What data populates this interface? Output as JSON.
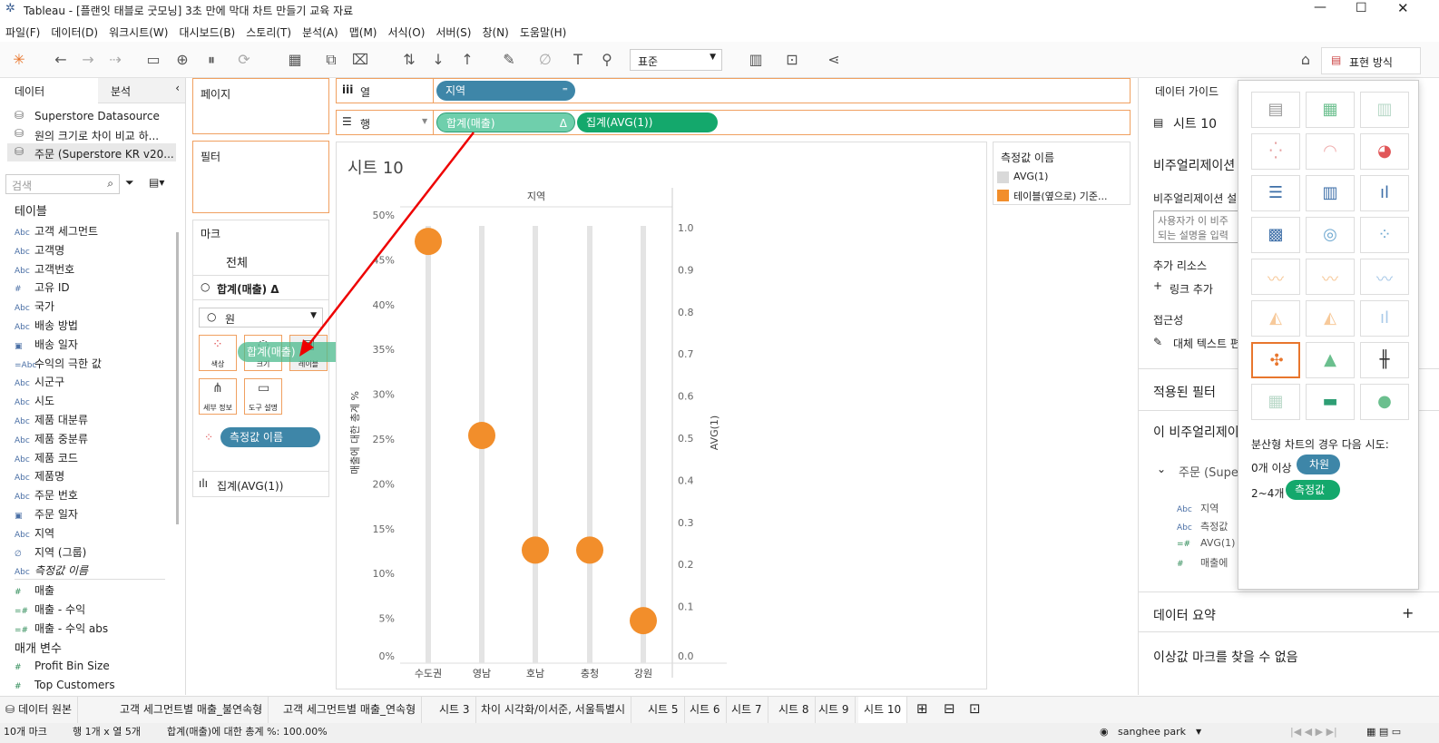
{
  "window": {
    "title": "Tableau - [플랜잇 태블로 굿모닝] 3초 만에 막대 차트 만들기 교육 자료"
  },
  "menu": [
    "파일(F)",
    "데이터(D)",
    "워크시트(W)",
    "대시보드(B)",
    "스토리(T)",
    "분석(A)",
    "맵(M)",
    "서식(O)",
    "서버(S)",
    "창(N)",
    "도움말(H)"
  ],
  "toolbar": {
    "fit": "표준",
    "show_me": "표현 방식"
  },
  "left": {
    "tab_data": "데이터",
    "tab_analysis": "분석",
    "sources": [
      "Superstore Datasource",
      "원의 크기로 차이 비교 하...",
      "주문 (Superstore KR v20..."
    ],
    "search_placeholder": "검색",
    "tables_header": "테이블",
    "fields": [
      {
        "icon": "Abc",
        "name": "고객 세그먼트"
      },
      {
        "icon": "Abc",
        "name": "고객명"
      },
      {
        "icon": "Abc",
        "name": "고객번호"
      },
      {
        "icon": "#",
        "name": "고유 ID"
      },
      {
        "icon": "Abc",
        "name": "국가"
      },
      {
        "icon": "Abc",
        "name": "배송 방법"
      },
      {
        "icon": "▣",
        "name": "배송 일자"
      },
      {
        "icon": "=Abc",
        "name": "수익의 극한 값"
      },
      {
        "icon": "Abc",
        "name": "시군구"
      },
      {
        "icon": "Abc",
        "name": "시도"
      },
      {
        "icon": "Abc",
        "name": "제품 대분류"
      },
      {
        "icon": "Abc",
        "name": "제품 중분류"
      },
      {
        "icon": "Abc",
        "name": "제품 코드"
      },
      {
        "icon": "Abc",
        "name": "제품명"
      },
      {
        "icon": "Abc",
        "name": "주문 번호"
      },
      {
        "icon": "▣",
        "name": "주문 일자"
      },
      {
        "icon": "Abc",
        "name": "지역"
      },
      {
        "icon": "∅",
        "name": "지역 (그룹)"
      },
      {
        "icon": "Abc",
        "name": "측정값 이름"
      }
    ],
    "measures": [
      {
        "icon": "#",
        "name": "매출"
      },
      {
        "icon": "=#",
        "name": "매출 - 수익"
      },
      {
        "icon": "=#",
        "name": "매출 - 수익 abs"
      }
    ],
    "params_header": "매개 변수",
    "params": [
      {
        "icon": "#",
        "name": "Profit Bin Size"
      },
      {
        "icon": "#",
        "name": "Top Customers"
      }
    ]
  },
  "pages": {
    "label": "페이지"
  },
  "filters": {
    "label": "필터"
  },
  "marks": {
    "label": "마크",
    "all": "전체",
    "measure": "합계(매출) Δ",
    "type": "원",
    "buttons": [
      "색상",
      "크기",
      "레이블",
      "세부 정보",
      "도구 설명"
    ],
    "color_pill": "측정값 이름",
    "drag_pill": "합계(매출)",
    "agg": "집계(AVG(1))"
  },
  "columns": {
    "label": "열",
    "pill": "지역"
  },
  "rows": {
    "label": "행",
    "pill1": "합계(매출)",
    "pill1_delta": "Δ",
    "pill2": "집계(AVG(1))"
  },
  "sheet": {
    "title": "시트 10",
    "header": "지역",
    "y_left_label": "매출에 대한 총계 %",
    "y_right_label": "AVG(1)"
  },
  "legend": {
    "title": "측정값 이름",
    "items": [
      {
        "label": "AVG(1)",
        "color": "#d9d9d9"
      },
      {
        "label": "테이블(옆으로) 기준...",
        "color": "#f28e2b"
      }
    ]
  },
  "chart_data": {
    "type": "scatter",
    "categories": [
      "수도권",
      "영남",
      "호남",
      "충청",
      "강원"
    ],
    "values": [
      0.47,
      0.25,
      0.12,
      0.12,
      0.04
    ],
    "ylim": [
      0,
      0.5
    ],
    "y_ticks": [
      "0%",
      "5%",
      "10%",
      "15%",
      "20%",
      "25%",
      "30%",
      "35%",
      "40%",
      "45%",
      "50%"
    ],
    "y2_ticks": [
      "0.0",
      "0.1",
      "0.2",
      "0.3",
      "0.4",
      "0.5",
      "0.6",
      "0.7",
      "0.8",
      "0.9",
      "1.0"
    ],
    "ylim2": [
      0,
      1
    ]
  },
  "guide": {
    "title": "데이터 가이드",
    "sheet": "시트 10",
    "viz_label": "비주얼리제이션",
    "viz_desc_label": "비주얼리제이션 설",
    "desc_placeholder": "사용자가 이 비주\n되는 설명을 입력",
    "resources": "추가 리소스",
    "add_link": "링크 추가",
    "access": "접근성",
    "alt_text": "대체 텍스트 편",
    "filters": "적용된 필터",
    "this_viz": "이 비주얼리제이",
    "source": "주문 (Supe",
    "fields": [
      {
        "icon": "Abc",
        "name": "지역"
      },
      {
        "icon": "Abc",
        "name": "측정값 "
      },
      {
        "icon": "=#",
        "name": "AVG(1)"
      },
      {
        "icon": "#",
        "name": "매출에 "
      }
    ],
    "summary": "데이터 요약",
    "outlier": "이상값 마크를 찾을 수 없음"
  },
  "showme": {
    "hint": "분산형 차트의 경우 다음 시도:",
    "row1_prefix": "0개 이상",
    "row1_pill": "차원",
    "row2_prefix": "2~4개",
    "row2_pill": "측정값"
  },
  "tabs": [
    "데이터 원본",
    "고객 세그먼트별 매출_불연속형",
    "고객 세그먼트별 매출_연속형",
    "시트 3",
    "차이 시각화/이서준, 서울특별시",
    "시트 5",
    "시트 6",
    "시트 7",
    "시트 8",
    "시트 9",
    "시트 10"
  ],
  "status": {
    "marks": "10개 마크",
    "dims": "행 1개 x 열 5개",
    "calc": "합계(매출)에 대한 총계 %: 100.00%",
    "user": "sanghee park"
  }
}
